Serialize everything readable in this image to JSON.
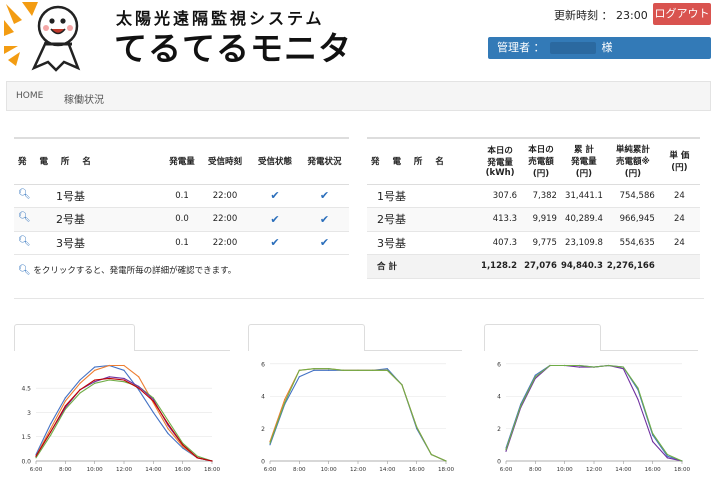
{
  "header": {
    "title_small": "太陽光遠隔監視システム",
    "title_big": "てるてるモニタ",
    "update_label": "更新時刻 ： 23:00",
    "logout_label": "ログアウト",
    "admin_prefix": "管理者 ：",
    "admin_suffix": "様"
  },
  "breadcrumb": {
    "home": "HOME",
    "current": "稼働状況"
  },
  "left_table": {
    "headers": [
      "発 電 所 名",
      "発電量",
      "受信時刻",
      "受信状態",
      "発電状況"
    ],
    "rows": [
      {
        "name": "1号基",
        "power": "0.1",
        "time": "22:00"
      },
      {
        "name": "2号基",
        "power": "0.0",
        "time": "22:00"
      },
      {
        "name": "3号基",
        "power": "0.1",
        "time": "22:00"
      }
    ]
  },
  "right_table": {
    "headers": {
      "name": "発 電 所 名",
      "gen_today_1": "本日の",
      "gen_today_2": "発電量",
      "gen_today_3": "(kWh)",
      "sales_today_1": "本日の",
      "sales_today_2": "売電額",
      "sales_today_3": "(円)",
      "cum_1": "累 計",
      "cum_2": "発電量",
      "cum_3": "(円)",
      "simple_1": "単純累計",
      "simple_2": "売電額※",
      "simple_3": "(円)",
      "unit_1": "単 価",
      "unit_2": "(円)"
    },
    "rows": [
      {
        "name": "1号基",
        "gen": "307.6",
        "sales": "7,382",
        "cum": "31,441.1",
        "simple": "754,586",
        "unit": "24"
      },
      {
        "name": "2号基",
        "gen": "413.3",
        "sales": "9,919",
        "cum": "40,289.4",
        "simple": "966,945",
        "unit": "24"
      },
      {
        "name": "3号基",
        "gen": "407.3",
        "sales": "9,775",
        "cum": "23,109.8",
        "simple": "554,635",
        "unit": "24"
      }
    ],
    "total": {
      "label": "合 計",
      "gen": "1,128.2",
      "sales": "27,076",
      "cum": "94,840.3",
      "simple": "2,276,166"
    }
  },
  "note": "をクリックすると、発電所毎の詳細が確認できます。",
  "colors": {
    "accent": "#337ab7",
    "logout": "#d9534f",
    "check": "#2a6ebb"
  },
  "chart_data": [
    {
      "type": "line",
      "x": [
        "6:00",
        "7:00",
        "8:00",
        "9:00",
        "10:00",
        "11:00",
        "12:00",
        "13:00",
        "14:00",
        "15:00",
        "16:00",
        "17:00",
        "18:00"
      ],
      "xticks": [
        "6:00",
        "8:00",
        "10:00",
        "12:00",
        "14:00",
        "16:00",
        "18:00"
      ],
      "yticks": [
        "0.0",
        "1.5",
        "3",
        "4.5"
      ],
      "ylim": [
        0,
        6.3
      ],
      "series": [
        {
          "color": "#4472c4",
          "values": [
            0.4,
            2.3,
            3.9,
            5.0,
            5.8,
            5.9,
            5.6,
            4.4,
            3.0,
            1.7,
            0.8,
            0.2,
            0.0
          ]
        },
        {
          "color": "#ed7d31",
          "values": [
            0.3,
            2.0,
            3.7,
            4.8,
            5.6,
            5.9,
            5.9,
            5.2,
            3.6,
            2.0,
            0.9,
            0.2,
            0.0
          ]
        },
        {
          "color": "#70ad47",
          "values": [
            0.2,
            1.6,
            3.2,
            4.2,
            4.8,
            5.0,
            4.9,
            4.6,
            3.9,
            2.5,
            1.1,
            0.3,
            0.0
          ]
        },
        {
          "color": "#7030a0",
          "values": [
            0.3,
            1.8,
            3.3,
            4.4,
            4.9,
            5.2,
            5.1,
            4.6,
            3.8,
            2.2,
            1.0,
            0.2,
            0.0
          ]
        },
        {
          "color": "#c00000",
          "values": [
            0.3,
            1.8,
            3.4,
            4.4,
            5.0,
            5.1,
            5.0,
            4.5,
            3.7,
            2.3,
            1.0,
            0.2,
            0.0
          ]
        }
      ]
    },
    {
      "type": "line",
      "x": [
        "6:00",
        "7:00",
        "8:00",
        "9:00",
        "10:00",
        "11:00",
        "12:00",
        "13:00",
        "14:00",
        "15:00",
        "16:00",
        "17:00",
        "18:00"
      ],
      "xticks": [
        "6:00",
        "8:00",
        "10:00",
        "12:00",
        "14:00",
        "16:00",
        "18:00"
      ],
      "yticks": [
        "0",
        "2",
        "4",
        "6"
      ],
      "ylim": [
        0,
        6.3
      ],
      "series": [
        {
          "color": "#4472c4",
          "values": [
            1.0,
            3.5,
            5.2,
            5.6,
            5.6,
            5.6,
            5.6,
            5.6,
            5.7,
            4.7,
            2.0,
            0.4,
            0.0
          ]
        },
        {
          "color": "#ed7d31",
          "values": [
            1.2,
            3.8,
            5.6,
            5.7,
            5.7,
            5.6,
            5.6,
            5.6,
            5.6,
            4.7,
            2.1,
            0.4,
            0.0
          ]
        },
        {
          "color": "#70ad47",
          "values": [
            1.1,
            3.6,
            5.6,
            5.7,
            5.7,
            5.6,
            5.6,
            5.6,
            5.6,
            4.7,
            2.1,
            0.4,
            0.0
          ]
        }
      ]
    },
    {
      "type": "line",
      "x": [
        "6:00",
        "7:00",
        "8:00",
        "9:00",
        "10:00",
        "11:00",
        "12:00",
        "13:00",
        "14:00",
        "15:00",
        "16:00",
        "17:00",
        "18:00"
      ],
      "xticks": [
        "6:00",
        "8:00",
        "10:00",
        "12:00",
        "14:00",
        "16:00",
        "18:00"
      ],
      "yticks": [
        "0",
        "2",
        "4",
        "6"
      ],
      "ylim": [
        0,
        6.3
      ],
      "series": [
        {
          "color": "#4472c4",
          "values": [
            0.8,
            3.5,
            5.3,
            5.9,
            5.9,
            5.9,
            5.8,
            5.9,
            5.8,
            4.4,
            1.6,
            0.3,
            0.0
          ]
        },
        {
          "color": "#7030a0",
          "values": [
            0.6,
            3.3,
            5.1,
            5.9,
            5.9,
            5.8,
            5.8,
            5.9,
            5.7,
            3.8,
            1.2,
            0.2,
            0.0
          ]
        },
        {
          "color": "#70ad47",
          "values": [
            0.7,
            3.4,
            5.2,
            5.9,
            5.9,
            5.9,
            5.8,
            5.9,
            5.8,
            4.5,
            1.7,
            0.4,
            0.0
          ]
        }
      ]
    }
  ]
}
